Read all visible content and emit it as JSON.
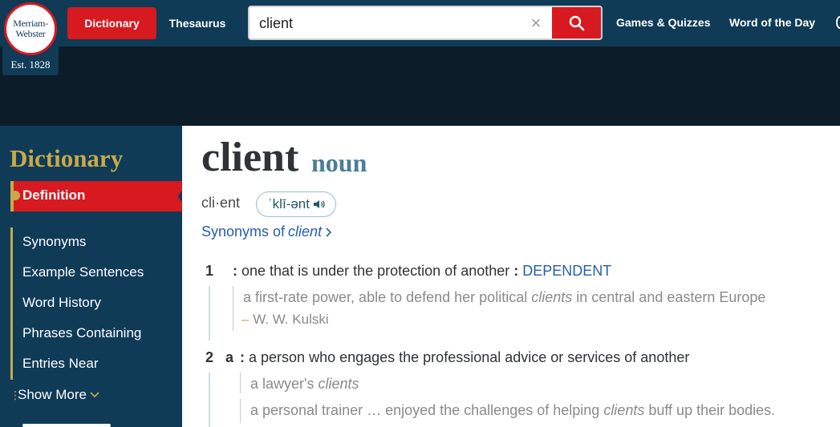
{
  "header": {
    "logo": {
      "line1": "Merriam-",
      "line2": "Webster",
      "est": "Est. 1828"
    },
    "dictionary_tab": "Dictionary",
    "thesaurus_tab": "Thesaurus",
    "search": {
      "value": "client",
      "placeholder": ""
    },
    "nav": [
      "Games & Quizzes",
      "Word of the Day"
    ]
  },
  "sidebar": {
    "title": "Dictionary",
    "active": "Definition",
    "items": [
      "Synonyms",
      "Example Sentences",
      "Word History",
      "Phrases Containing",
      "Entries Near"
    ],
    "show_more": "Show More"
  },
  "entry": {
    "headword": "client",
    "pos": "noun",
    "syllables": "cli·ent",
    "pronunciation": "ˈklī-ənt",
    "synonyms_prefix": "Synonyms of",
    "synonyms_word": "client",
    "senses": [
      {
        "num": "1",
        "letter": "",
        "definition": "one that is under the protection of another",
        "xref": "DEPENDENT",
        "examples": [
          {
            "before": "a first-rate power, able to defend her political",
            "italic": "clients",
            "after": "in central and eastern Europe",
            "author": "W. W. Kulski"
          }
        ]
      },
      {
        "num": "2",
        "letter": "a",
        "definition": "a person who engages the professional advice or services of another",
        "xref": "",
        "examples": [
          {
            "before": "a lawyer's",
            "italic": "clients",
            "after": ""
          },
          {
            "before": "a personal trainer … enjoyed the challenges of helping",
            "italic": "clients",
            "after": "buff up their bodies."
          }
        ]
      }
    ]
  },
  "colors": {
    "header_bg": "#0f3b57",
    "brand_red": "#d71920",
    "gold": "#c8a94a",
    "link_blue": "#265eaa"
  }
}
